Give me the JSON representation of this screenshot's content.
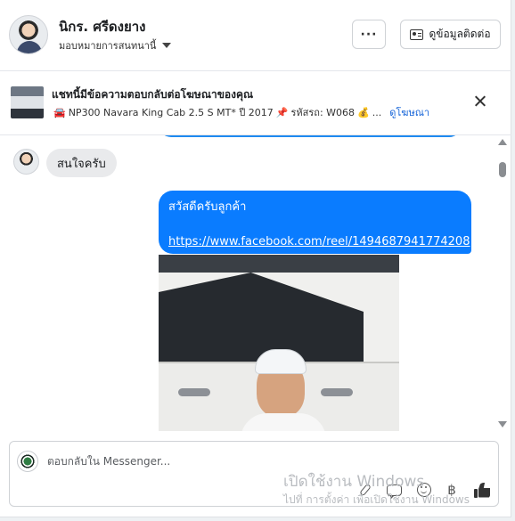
{
  "header": {
    "contact_name": "นิกร. ศรีดงยาง",
    "assign_label": "มอบหมายการสนทนานี้",
    "more_label": "···",
    "view_contact_label": "ดูข้อมูลติดต่อ"
  },
  "ad_banner": {
    "title": "แชทนี้มีข้อความตอบกลับต่อโฆษณาของคุณ",
    "car_emoji": "🚘",
    "details": "NP300 Navara King Cab 2.5 S MT* ปี 2017",
    "pin_emoji": "📌",
    "code": "รหัสรถ: W068",
    "money_emoji": "💰",
    "ellipsis": "...",
    "view_ad_label": "ดูโฆษณา"
  },
  "messages": {
    "incoming_text": "สนใจครับ",
    "outgoing_greeting": "สวัสดีครับลูกค้า",
    "outgoing_link": "https://www.facebook.com/reel/1494687941774208"
  },
  "composer": {
    "placeholder": "ตอบกลับใน Messenger...",
    "baht_symbol": "฿"
  },
  "watermark": {
    "line1": "เปิดใช้งาน Windows",
    "line2": "ไปที่ การตั้งค่า เพื่อเปิดใช้งาน Windows"
  },
  "colors": {
    "outgoing_bubble": "#0a7cff",
    "incoming_bubble": "#e9eaec",
    "link": "#1463d8"
  }
}
